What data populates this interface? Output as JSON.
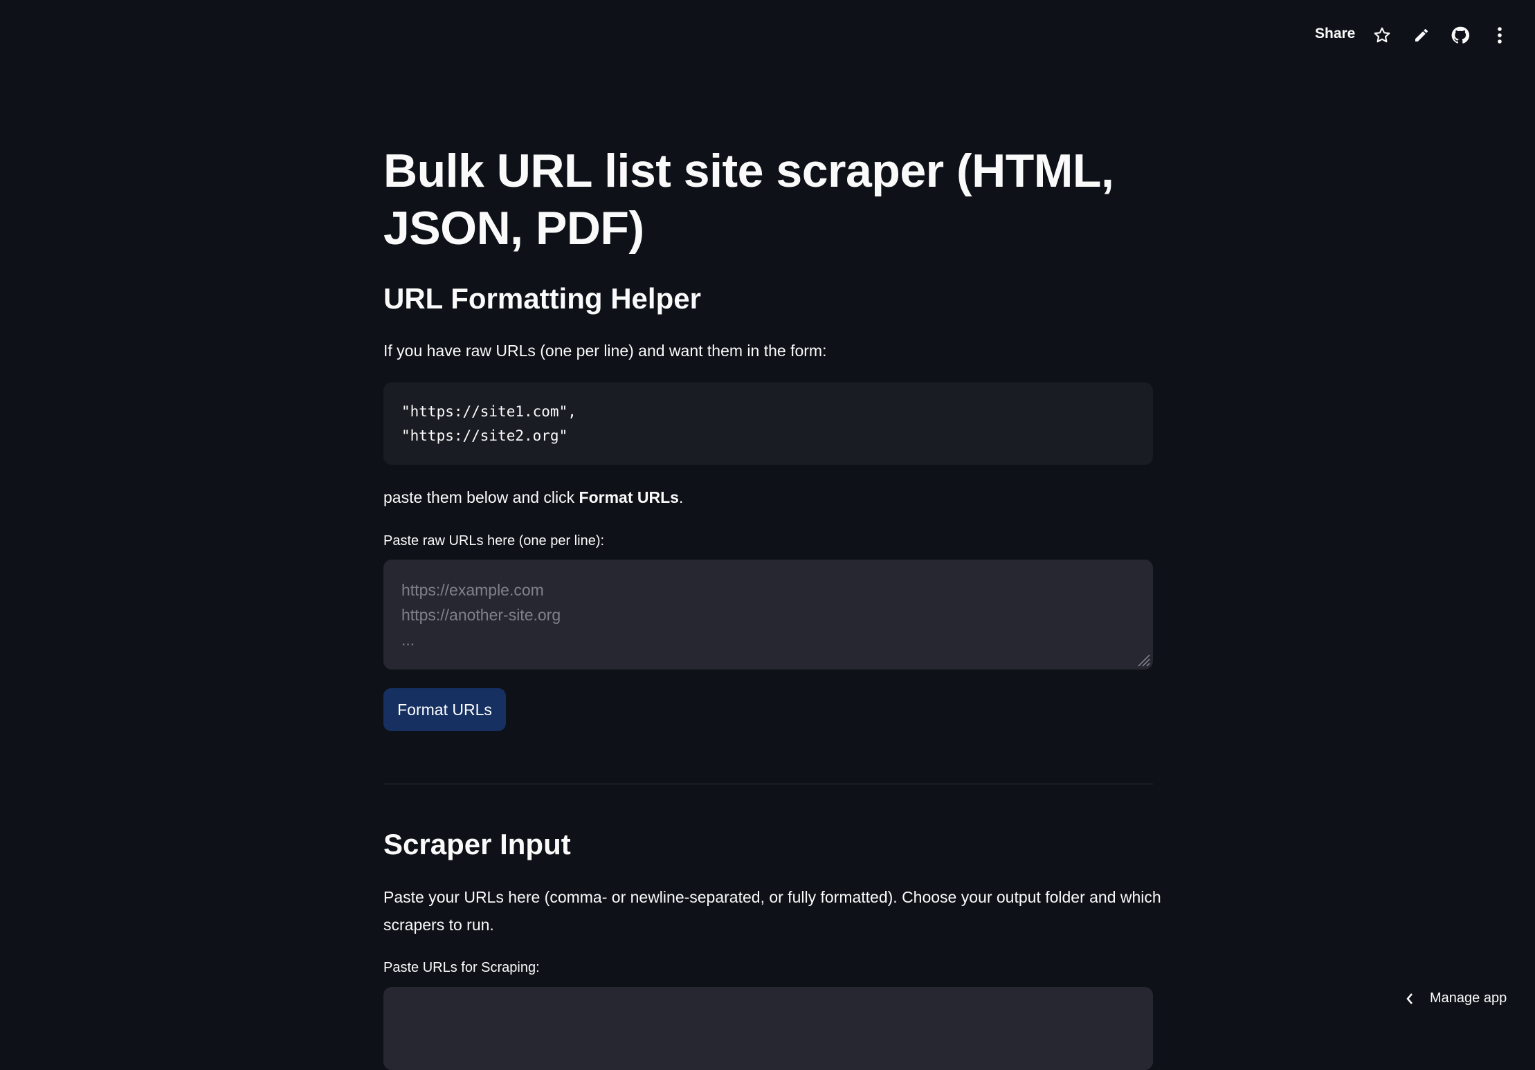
{
  "toolbar": {
    "share_label": "Share",
    "icons": [
      "star-icon",
      "pencil-icon",
      "github-icon",
      "more-vertical-icon"
    ]
  },
  "main": {
    "title": "Bulk URL list site scraper (HTML, JSON, PDF)",
    "helper": {
      "heading": "URL Formatting Helper",
      "intro": "If you have raw URLs (one per line) and want them in the form:",
      "code_example": "\"https://site1.com\",\n\"https://site2.org\"",
      "instruction_prefix": "paste them below and click ",
      "instruction_bold": "Format URLs",
      "instruction_suffix": ".",
      "input_label": "Paste raw URLs here (one per line):",
      "input_placeholder": "https://example.com\nhttps://another-site.org\n...",
      "input_value": "",
      "button_label": "Format URLs"
    },
    "scraper": {
      "heading": "Scraper Input",
      "description": "Paste your URLs here (comma- or newline-separated, or fully formatted). Choose your output folder and which scrapers to run.",
      "input_label": "Paste URLs for Scraping:",
      "input_value": ""
    }
  },
  "footer": {
    "manage_label": "Manage app"
  },
  "colors": {
    "background": "#0e1117",
    "button": "#163061",
    "input": "#262730",
    "code": "#1a1c24"
  }
}
